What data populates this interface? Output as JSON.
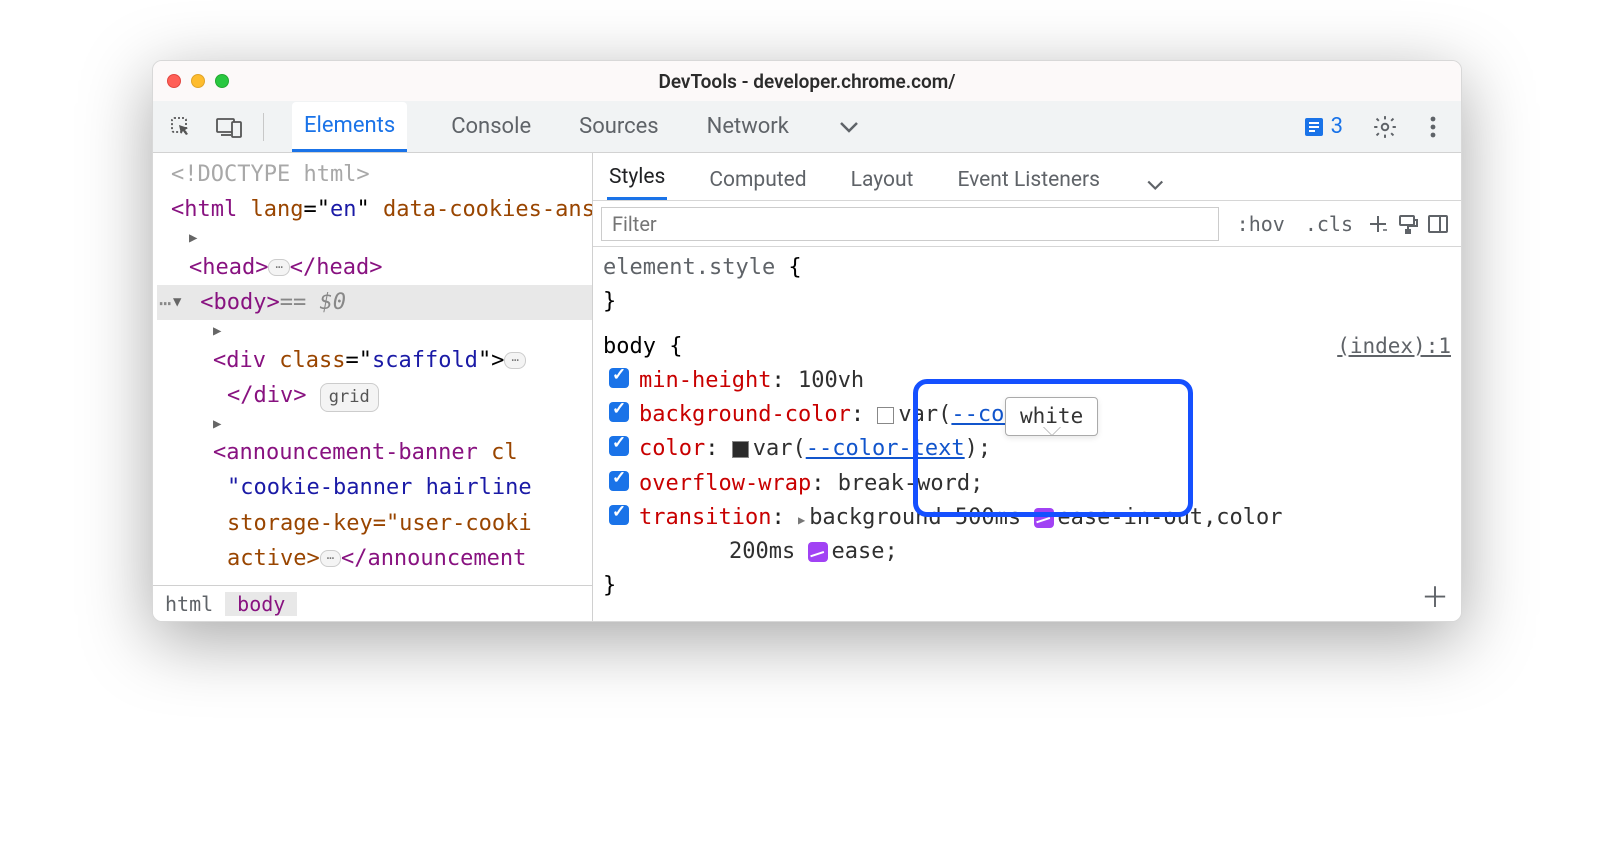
{
  "window": {
    "title": "DevTools - developer.chrome.com/"
  },
  "toolbar": {
    "tabs": [
      "Elements",
      "Console",
      "Sources",
      "Network"
    ],
    "active_index": 0,
    "issues_count": "3"
  },
  "dom": {
    "doctype": "<!DOCTYPE html>",
    "html_open": {
      "tag_open": "<html ",
      "attr1_name": "lang",
      "attr1_eq": "=\"",
      "attr1_val": "en",
      "attr1_close": "\" ",
      "rest": "data-cookies-answered data-banner-dismissed",
      "close": ">"
    },
    "head": {
      "open": "<head>",
      "close": "</head>"
    },
    "body_line": {
      "open": "<body>",
      "sel": " == $0"
    },
    "scaffold": {
      "open": "<div ",
      "attr": "class",
      "eq": "=\"",
      "val": "scaffold",
      "close": "\">",
      "end": "</div>",
      "pill": "grid"
    },
    "banner": {
      "open": "<announcement-banner ",
      "cl": "cl",
      "attr_row2": "\"cookie-banner hairline",
      "attr_row3": "storage-key=\"user-cooki",
      "attr_row4": "active>",
      "end": "</announcement"
    }
  },
  "breadcrumbs": [
    "html",
    "body"
  ],
  "subtabs": {
    "items": [
      "Styles",
      "Computed",
      "Layout",
      "Event Listeners"
    ],
    "active_index": 0
  },
  "filter": {
    "placeholder": "Filter",
    "hov": ":hov",
    "cls": ".cls"
  },
  "styles_pane": {
    "rule0": {
      "selector": "element.style",
      "brace": " {",
      "close": "}"
    },
    "rule1": {
      "selector": "body",
      "brace": " {",
      "source": "(index):1",
      "d0": {
        "prop": "min-height",
        "val": "100vh"
      },
      "d1": {
        "prop": "background-color",
        "valp": "var(",
        "varname": "--color-bg",
        "vale": ")"
      },
      "d2": {
        "prop": "color",
        "valp": "var(",
        "varname": "--color-text",
        "vale": ");"
      },
      "d3": {
        "prop": "overflow-wrap",
        "val": "break-word;"
      },
      "d4": {
        "prop": "transition",
        "v1": "background 500ms ",
        "e1": "ease-in-out",
        "sep": ",color",
        "v2": "200ms ",
        "e2": "ease;"
      },
      "close": "}"
    }
  },
  "tooltip": {
    "text": "white"
  }
}
